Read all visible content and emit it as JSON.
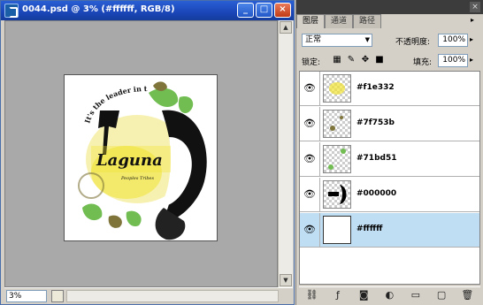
{
  "document": {
    "title": "0044.psd @ 3% (#ffffff, RGB/8)",
    "zoom": "3%"
  },
  "artwork": {
    "arc_text": "It's the leader in the California",
    "main_word": "Laguna",
    "sub_word": "Peoples Tribes"
  },
  "layers_panel": {
    "tabs": [
      "图层",
      "通道",
      "路径"
    ],
    "active_tab": 0,
    "blend_mode": "正常",
    "opacity_label": "不透明度:",
    "opacity_value": "100%",
    "lock_label": "锁定:",
    "fill_label": "填充:",
    "fill_value": "100%",
    "layers": [
      {
        "name": "#f1e332",
        "thumb_color": "#f1e332",
        "selected": false
      },
      {
        "name": "#7f753b",
        "thumb_color": "#7f753b",
        "selected": false
      },
      {
        "name": "#71bd51",
        "thumb_color": "#71bd51",
        "selected": false
      },
      {
        "name": "#000000",
        "thumb_color": "#000000",
        "selected": false
      },
      {
        "name": "#ffffff",
        "thumb_color": "#ffffff",
        "selected": true
      }
    ]
  },
  "colors": {
    "titlebar": "#2a5fd4",
    "selection": "#c0def3",
    "canvas_bg": "#a9a9a9"
  }
}
